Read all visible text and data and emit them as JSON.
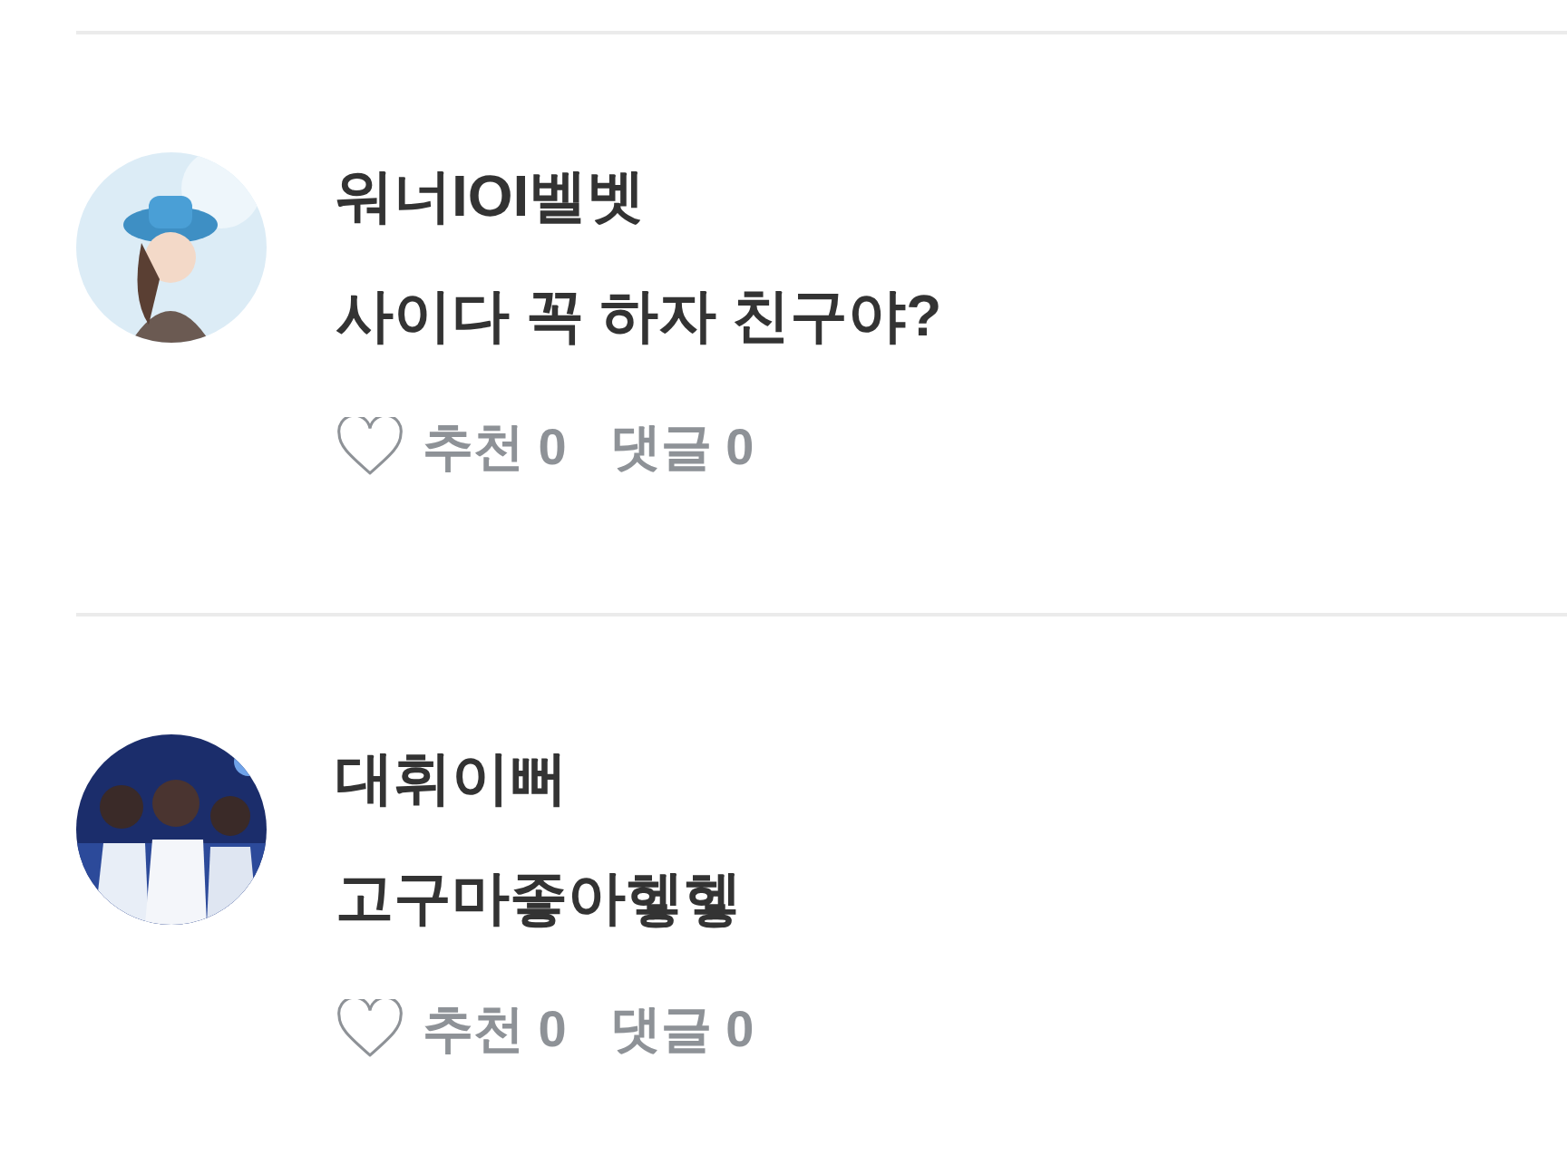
{
  "comments": [
    {
      "author": "워너IOI벨벳",
      "text": "사이다 꼭 하자 친구야?",
      "likes": "추천 0",
      "replies": "댓글 0",
      "liked": false
    },
    {
      "author": "대휘이뻐",
      "text": "고구마좋아헿헿",
      "likes": "추천 0",
      "replies": "댓글 0",
      "liked": false
    }
  ]
}
